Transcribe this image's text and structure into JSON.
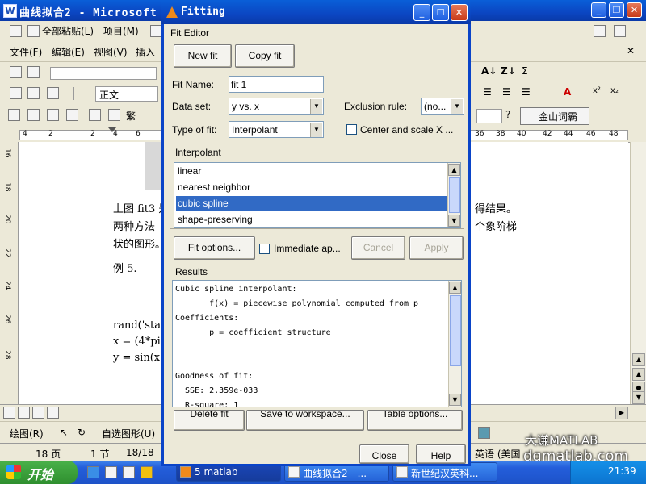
{
  "word": {
    "title": "曲线拟合2 - Microsoft W",
    "toolbar1": [
      "全部粘贴(L)",
      "项目(M)"
    ],
    "menu": [
      "文件(F)",
      "编辑(E)",
      "视图(V)",
      "插入"
    ],
    "style_box": "正文",
    "toolbar_right": "金山词霸",
    "ruler_left": [
      "4",
      "2",
      "2",
      "4",
      "6"
    ],
    "ruler_right": [
      "36",
      "38",
      "40",
      "42",
      "44",
      "46",
      "48"
    ],
    "vruler": [
      "16",
      "18",
      "20",
      "22",
      "24",
      "26",
      "28"
    ],
    "doc_lines": {
      "l1": "上图 fit3 是",
      "l1r": "得结果。",
      "l2": "两种方法",
      "l2r": "个象阶梯",
      "l3": "状的图形。",
      "l4": "例 5.",
      "l5": "rand('state'",
      "l6": "x = (4*pi)*",
      "l7": "y = sin(x)"
    },
    "drawbar": [
      "绘图(R)",
      "自选图形(U)"
    ],
    "status": [
      "18 页",
      "1 节",
      "18/18"
    ],
    "status_right": "英语 (美国",
    "watermark1": "大谦MATLAB",
    "watermark2": "dgmatlab.com"
  },
  "taskbar": {
    "start": "开始",
    "tasks": [
      "5 matlab",
      "曲线拟合2 - ...",
      "新世纪汉英科..."
    ],
    "clock": "21:39"
  },
  "dialog": {
    "title": "Fitting",
    "section": "Fit Editor",
    "new_fit": "New fit",
    "copy_fit": "Copy fit",
    "fit_name_label": "Fit Name:",
    "fit_name_value": "fit 1",
    "dataset_label": "Data set:",
    "dataset_value": "y vs. x",
    "exclusion_label": "Exclusion rule:",
    "exclusion_value": "(no...",
    "type_label": "Type of fit:",
    "type_value": "Interpolant",
    "center_label": "Center and scale X ...",
    "interpolant_group": "Interpolant",
    "interpolant_items": [
      "linear",
      "nearest neighbor",
      "cubic spline",
      "shape-preserving"
    ],
    "fit_options": "Fit options...",
    "immediate": "Immediate ap...",
    "cancel": "Cancel",
    "apply": "Apply",
    "results_label": "Results",
    "results_lines": [
      "Cubic spline interpolant:",
      "       f(x) = piecewise polynomial computed from p",
      "Coefficients:",
      "       p = coefficient structure",
      "",
      "",
      "Goodness of fit:",
      "  SSE: 2.359e-033",
      "  R-square: 1"
    ],
    "bottom_buttons": [
      "Delete fit",
      "Save to workspace...",
      "Table options..."
    ],
    "close": "Close",
    "help": "Help"
  }
}
